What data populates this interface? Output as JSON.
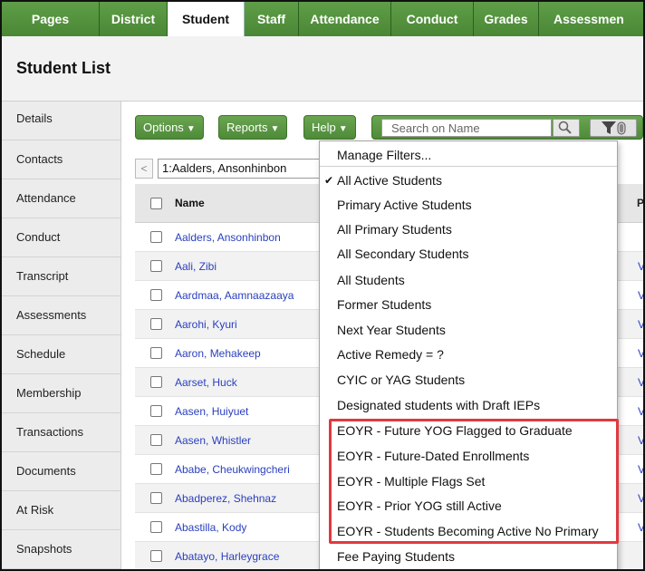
{
  "tabs": [
    "Pages",
    "District",
    "Student",
    "Staff",
    "Attendance",
    "Conduct",
    "Grades",
    "Assessmen"
  ],
  "active_tab": "Student",
  "page_title": "Student List",
  "sidebar": {
    "items": [
      "Details",
      "Contacts",
      "Attendance",
      "Conduct",
      "Transcript",
      "Assessments",
      "Schedule",
      "Membership",
      "Transactions",
      "Documents",
      "At Risk",
      "Snapshots"
    ]
  },
  "toolbar": {
    "options_label": "Options",
    "reports_label": "Reports",
    "help_label": "Help",
    "search_placeholder": "Search on Name"
  },
  "pager": {
    "prev_label": "<",
    "current_value": "1:Aalders, Ansonhinbon"
  },
  "table": {
    "name_header": "Name",
    "last_header": "P",
    "rows": [
      {
        "name": "Aalders, Ansonhinbon",
        "link": ""
      },
      {
        "name": "Aali, Zibi",
        "link": "V"
      },
      {
        "name": "Aardmaa, Aamnaazaaya",
        "link": "V"
      },
      {
        "name": "Aarohi, Kyuri",
        "link": "V"
      },
      {
        "name": "Aaron, Mehakeep",
        "link": "V"
      },
      {
        "name": "Aarset, Huck",
        "link": "V"
      },
      {
        "name": "Aasen, Huiyuet",
        "link": "V"
      },
      {
        "name": "Aasen, Whistler",
        "link": "V"
      },
      {
        "name": "Ababe, Cheukwingcheri",
        "link": "V"
      },
      {
        "name": "Abadperez, Shehnaz",
        "link": "V"
      },
      {
        "name": "Abastilla, Kody",
        "link": "V"
      },
      {
        "name": "Abatayo, Harleygrace",
        "link": ""
      }
    ]
  },
  "dropdown": {
    "items": [
      "Manage Filters...",
      "All Active Students",
      "Primary Active Students",
      "All Primary Students",
      "All Secondary Students",
      "All Students",
      "Former Students",
      "Next Year Students",
      "Active Remedy = ?",
      "CYIC or YAG Students",
      "Designated students with Draft IEPs",
      "EOYR - Future YOG Flagged to Graduate",
      "EOYR - Future-Dated Enrollments",
      "EOYR - Multiple Flags Set",
      "EOYR - Prior YOG still Active",
      "EOYR - Students Becoming Active No Primary",
      "Fee Paying Students"
    ],
    "checked_index": 1,
    "highlighted_range": [
      11,
      15
    ]
  },
  "colors": {
    "tab_green": "#4f8f3a",
    "link_blue": "#2a3fbf",
    "highlight_red": "#e0393e"
  }
}
